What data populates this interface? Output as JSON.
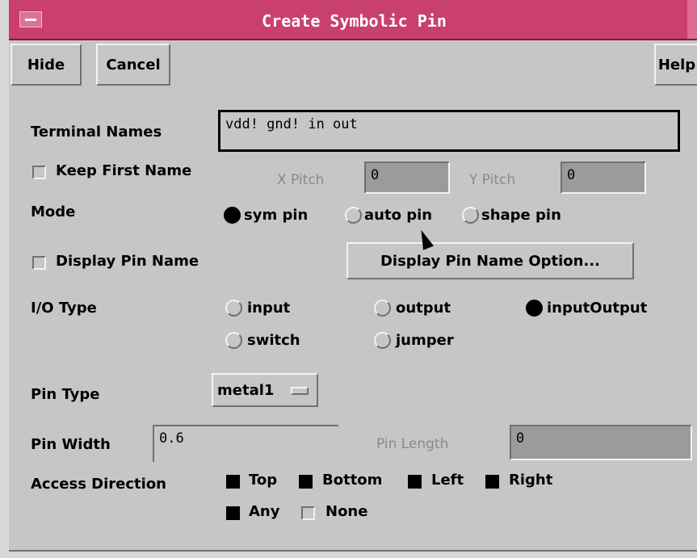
{
  "window": {
    "title": "Create Symbolic Pin"
  },
  "toolbar": {
    "hide": "Hide",
    "cancel": "Cancel",
    "help": "Help"
  },
  "terminal_names": {
    "label": "Terminal Names",
    "value": "vdd! gnd! in out"
  },
  "keep_first_name": {
    "label": "Keep First Name",
    "checked": false
  },
  "x_pitch": {
    "label": "X Pitch",
    "value": "0"
  },
  "y_pitch": {
    "label": "Y Pitch",
    "value": "0"
  },
  "mode": {
    "label": "Mode",
    "options": [
      "sym pin",
      "auto pin",
      "shape pin"
    ],
    "selected": "sym pin"
  },
  "display_pin_name": {
    "label": "Display Pin Name",
    "checked": false,
    "option_button": "Display Pin Name Option..."
  },
  "io_type": {
    "label": "I/O Type",
    "options": [
      "input",
      "output",
      "inputOutput",
      "switch",
      "jumper"
    ],
    "selected": "inputOutput"
  },
  "pin_type": {
    "label": "Pin Type",
    "value": "metal1"
  },
  "pin_width": {
    "label": "Pin Width",
    "value": "0.6"
  },
  "pin_length": {
    "label": "Pin Length",
    "value": "0"
  },
  "access_direction": {
    "label": "Access Direction",
    "options": [
      "Top",
      "Bottom",
      "Left",
      "Right",
      "Any",
      "None"
    ],
    "checked": [
      "Top",
      "Bottom",
      "Left",
      "Right",
      "Any"
    ]
  }
}
